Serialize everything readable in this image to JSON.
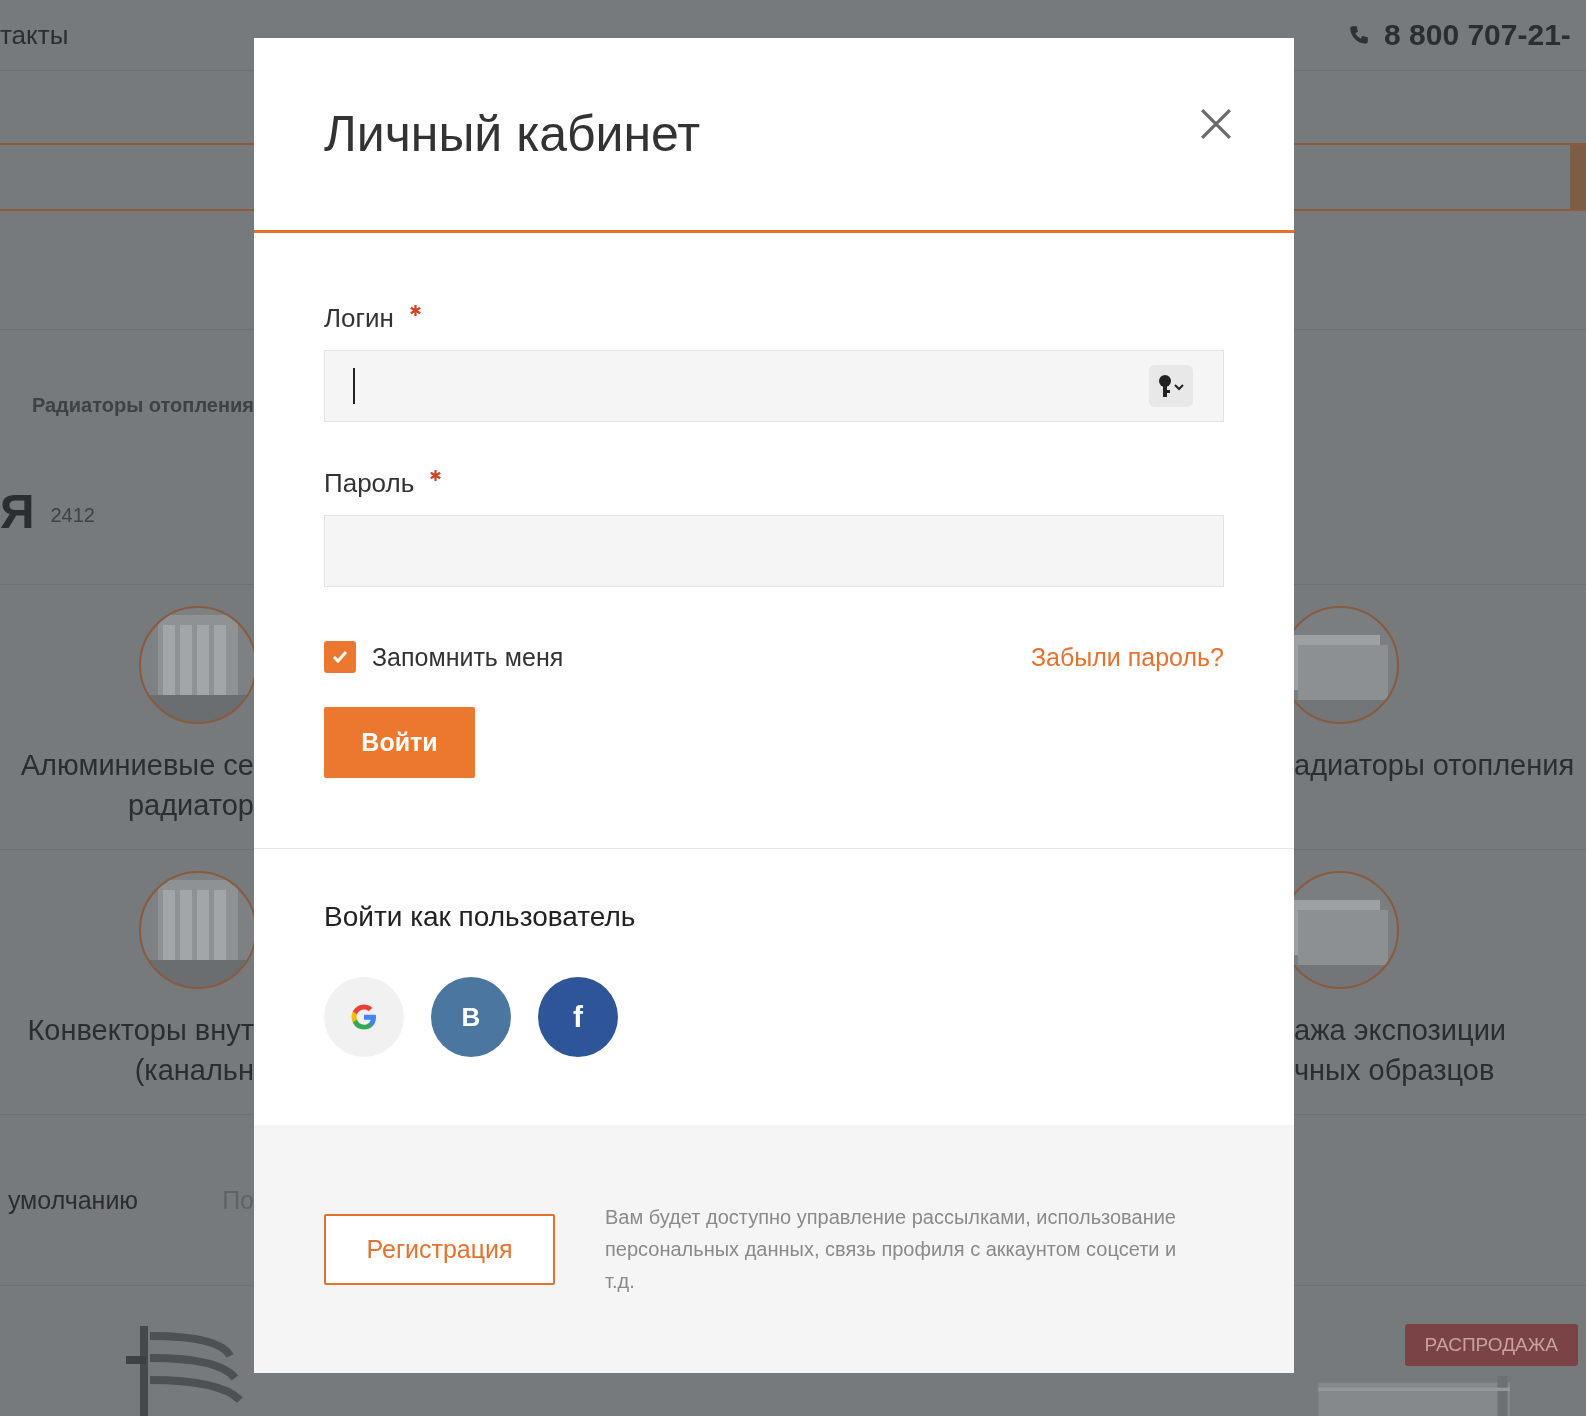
{
  "background": {
    "nav_link": "такты",
    "phone": "8 800 707-21-",
    "breadcrumb": "Радиаторы отопления",
    "heading": "Я",
    "count": "2412",
    "left_categories": [
      {
        "lines": [
          "Алюминиевые се",
          "радиатор"
        ]
      },
      {
        "lines": [
          "Конвекторы внут",
          "(канальн"
        ]
      }
    ],
    "right_categories": [
      {
        "lines": [
          "адиаторы отопления"
        ]
      },
      {
        "lines": [
          "ажа экспозиции",
          "чных образцов"
        ]
      }
    ],
    "sort_options": [
      "умолчанию",
      "По"
    ],
    "sale_badge": "РАСПРОДАЖА"
  },
  "modal": {
    "title": "Личный кабинет",
    "fields": [
      {
        "label": "Логин",
        "required": true,
        "focused": true,
        "key_button": true
      },
      {
        "label": "Пароль",
        "required": true,
        "focused": false,
        "key_button": false
      }
    ],
    "remember": {
      "label": "Запомнить меня",
      "checked": true
    },
    "forgot_link": "Забыли пароль?",
    "login_button": "Войти",
    "social_title": "Войти как пользователь",
    "social": [
      {
        "kind": "google"
      },
      {
        "kind": "vk",
        "label": "B"
      },
      {
        "kind": "facebook",
        "label": "f"
      }
    ],
    "register_button": "Регистрация",
    "register_note": "Вам будет доступно управление рассылками, использование персональных данных, связь профиля с аккаунтом соцсети и т.д."
  }
}
